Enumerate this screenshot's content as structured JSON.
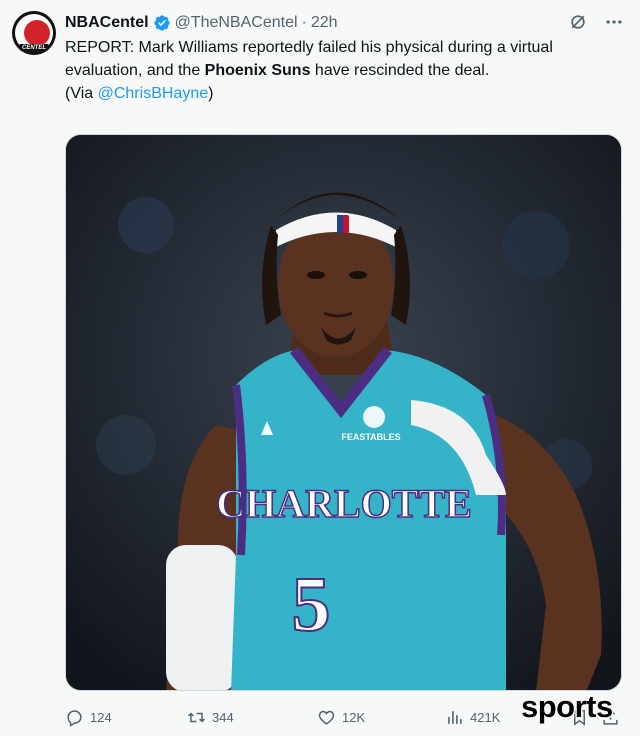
{
  "tweet": {
    "author_name": "NBACentel",
    "handle": "@TheNBACentel",
    "separator": "·",
    "time": "22h",
    "avatar_text": "CENTEL",
    "text_part1": "REPORT: Mark Williams reportedly failed his physical during a virtual evaluation, and the ",
    "text_bold": "Phoenix Suns",
    "text_part2": " have rescinded the deal.",
    "via_prefix": "(Via ",
    "via_mention": "@ChrisBHayne",
    "via_suffix": ")"
  },
  "media": {
    "jersey_text": "CHARLOTTE",
    "jersey_number": "5",
    "patch_text": "FEASTABLES"
  },
  "actions": {
    "replies": "124",
    "retweets": "344",
    "likes": "12K",
    "views": "421K"
  },
  "watermark": "sports",
  "colors": {
    "accent": "#1d9bf0",
    "secondary_text": "#536471",
    "jersey_teal": "#34b3c9",
    "jersey_purple": "#4b2e83"
  },
  "icons": [
    "verified-badge-icon",
    "grok-icon",
    "more-icon",
    "reply-icon",
    "retweet-icon",
    "like-icon",
    "views-icon",
    "bookmark-icon",
    "share-icon"
  ]
}
